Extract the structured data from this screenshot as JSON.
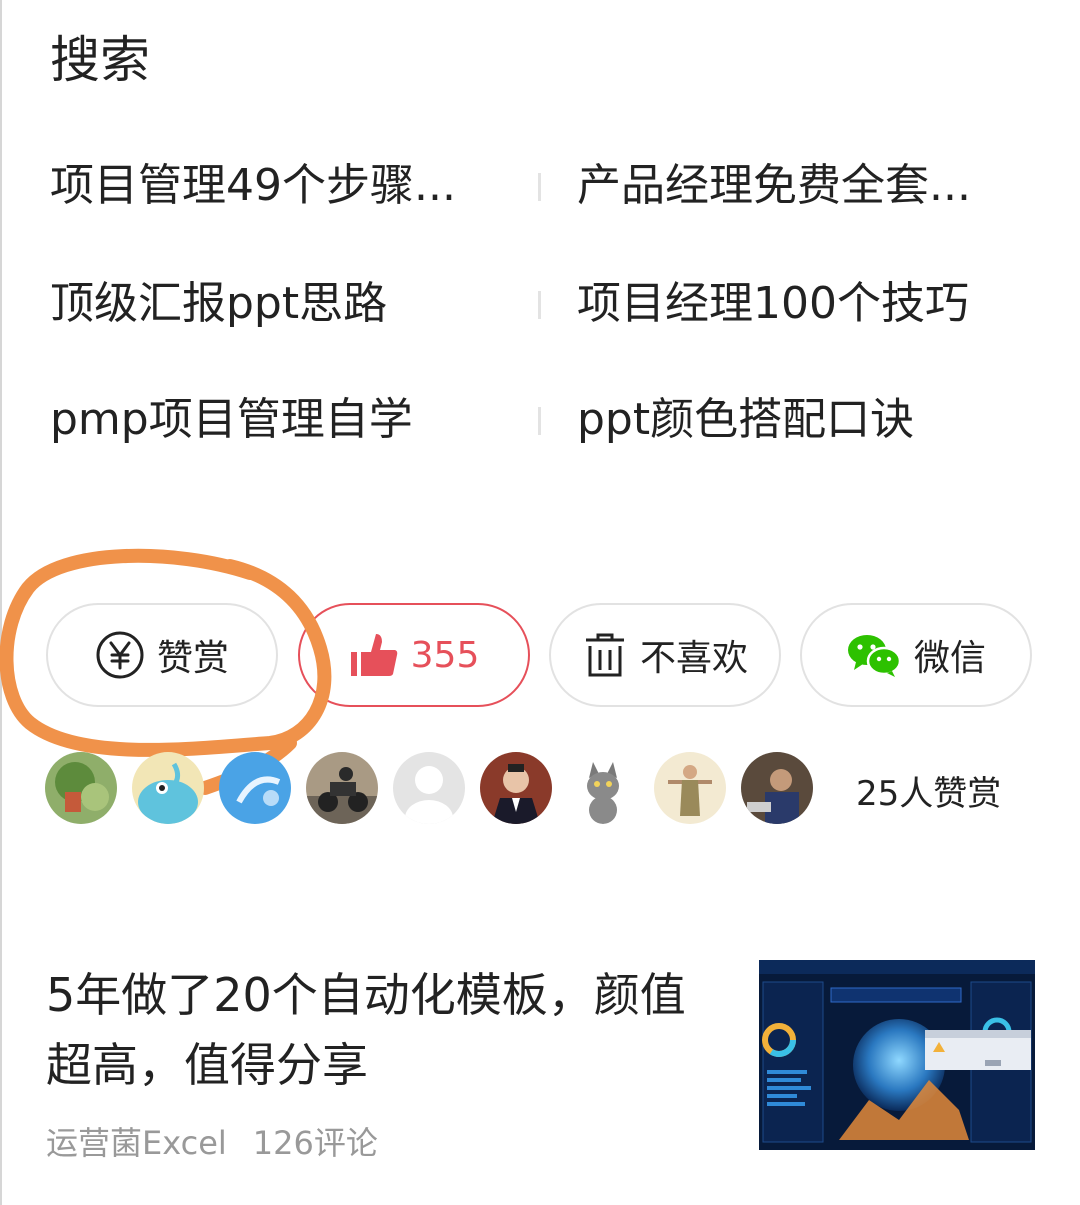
{
  "search": {
    "title": "搜索",
    "suggestions": [
      "项目管理49个步骤...",
      "产品经理免费全套...",
      "顶级汇报ppt思路",
      "项目经理100个技巧",
      "pmp项目管理自学",
      "ppt颜色搭配口诀"
    ]
  },
  "actions": {
    "reward_label": "赞赏",
    "like_count": "355",
    "dislike_label": "不喜欢",
    "share_label": "微信",
    "like_color": "#e6505a",
    "wechat_color": "#2dc100",
    "highlight_color": "#f0924a"
  },
  "rewarders": {
    "avatars": [
      "nature-avatar",
      "cartoon-avatar",
      "sky-avatar",
      "motorcycle-avatar",
      "default-avatar",
      "man-suit-avatar",
      "cat-avatar",
      "figure-avatar",
      "person-avatar"
    ],
    "count_label": "25人赞赏"
  },
  "article": {
    "title": "5年做了20个自动化模板，颜值超高，值得分享",
    "author": "运营菌Excel",
    "comments": "126评论",
    "thumbnail_icon": "dashboard-thumbnail"
  }
}
